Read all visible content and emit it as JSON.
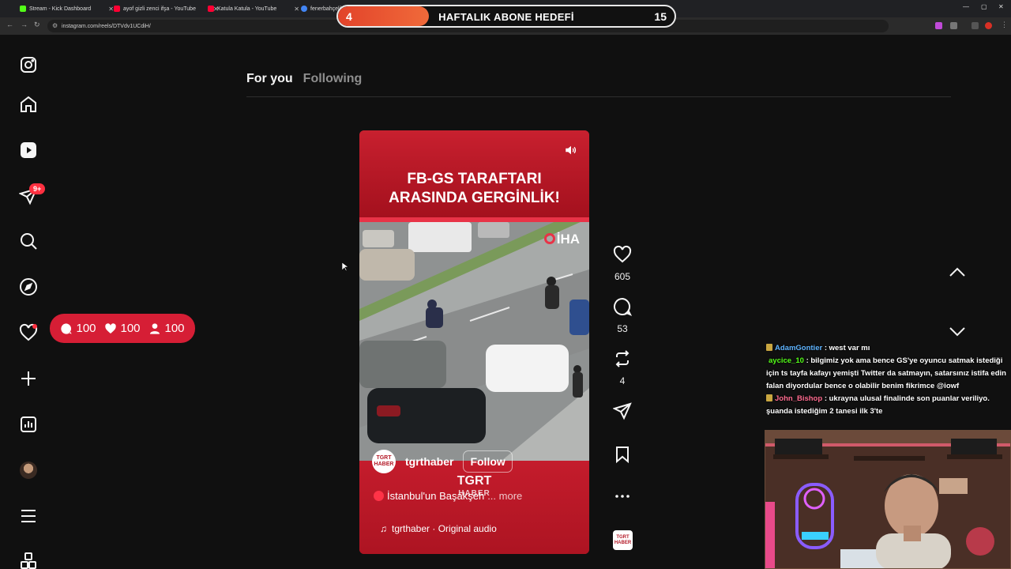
{
  "browser": {
    "tabs": [
      {
        "title": "Stream - Kick Dashboard",
        "color": "#53fc18"
      },
      {
        "title": "ayof gizli zenci ifşa - YouTube",
        "color": "#ff0033"
      },
      {
        "title": "Katula Katula - YouTube",
        "color": "#ff0033"
      },
      {
        "title": "fenerbahçelile...",
        "color": "#4285f4"
      }
    ],
    "url": "instagram.com/reels/DTVdv1UCdiH/"
  },
  "goal": {
    "current": "4",
    "label": "HAFTALIK ABONE HEDEFİ",
    "target": "15",
    "progress": 0.27,
    "fill_color": "#e2432a"
  },
  "sidebar": {
    "icons": [
      "instagram-icon",
      "home-icon",
      "reels-icon",
      "messages-icon",
      "search-icon",
      "explore-icon",
      "notifications-icon",
      "create-icon",
      "dashboard-icon",
      "profile-avatar",
      "menu-icon",
      "more-apps-icon"
    ],
    "messages_badge": "9+"
  },
  "stats_overlay": {
    "comments": "100",
    "likes": "100",
    "followers": "100",
    "color": "#d61e35"
  },
  "feed_tabs": {
    "for_you": "For you",
    "following": "Following"
  },
  "reel": {
    "title": "FB-GS TARAFTARI\nARASINDA GERGİNLİK!",
    "brand": "İHA",
    "author": "tgrthaber",
    "author_avatar_text": "TGRT\nHABER",
    "follow": "Follow",
    "watermark": "TGRT",
    "watermark_sub": "HABER",
    "caption": "İstanbul'un Başakşeh",
    "caption_more": "... more",
    "audio": "tgrthaber · Original audio",
    "likes": "605",
    "comments": "53",
    "reposts": "4",
    "thumb_text": "TGRT\nHABER",
    "accent_color": "#b41a28"
  },
  "chat": [
    {
      "user": "AdamGontier",
      "color": "#5fb4ff",
      "message": ": west var mı"
    },
    {
      "user": "aycice_10",
      "color": "#53fc18",
      "message": ": bilgimiz yok ama bence GS'ye oyuncu satmak istediği için ts tayfa kafayı yemişti Twitter da satmayın, satarsınız istifa edin falan diyordular bence o olabilir benim fikrimce @iowf"
    },
    {
      "user": "John_Bishop",
      "color": "#ff6b8f",
      "message": ": ukrayna ulusal finalinde son puanlar veriliyo. şuanda istediğim 2 tanesi ilk 3'te"
    }
  ]
}
